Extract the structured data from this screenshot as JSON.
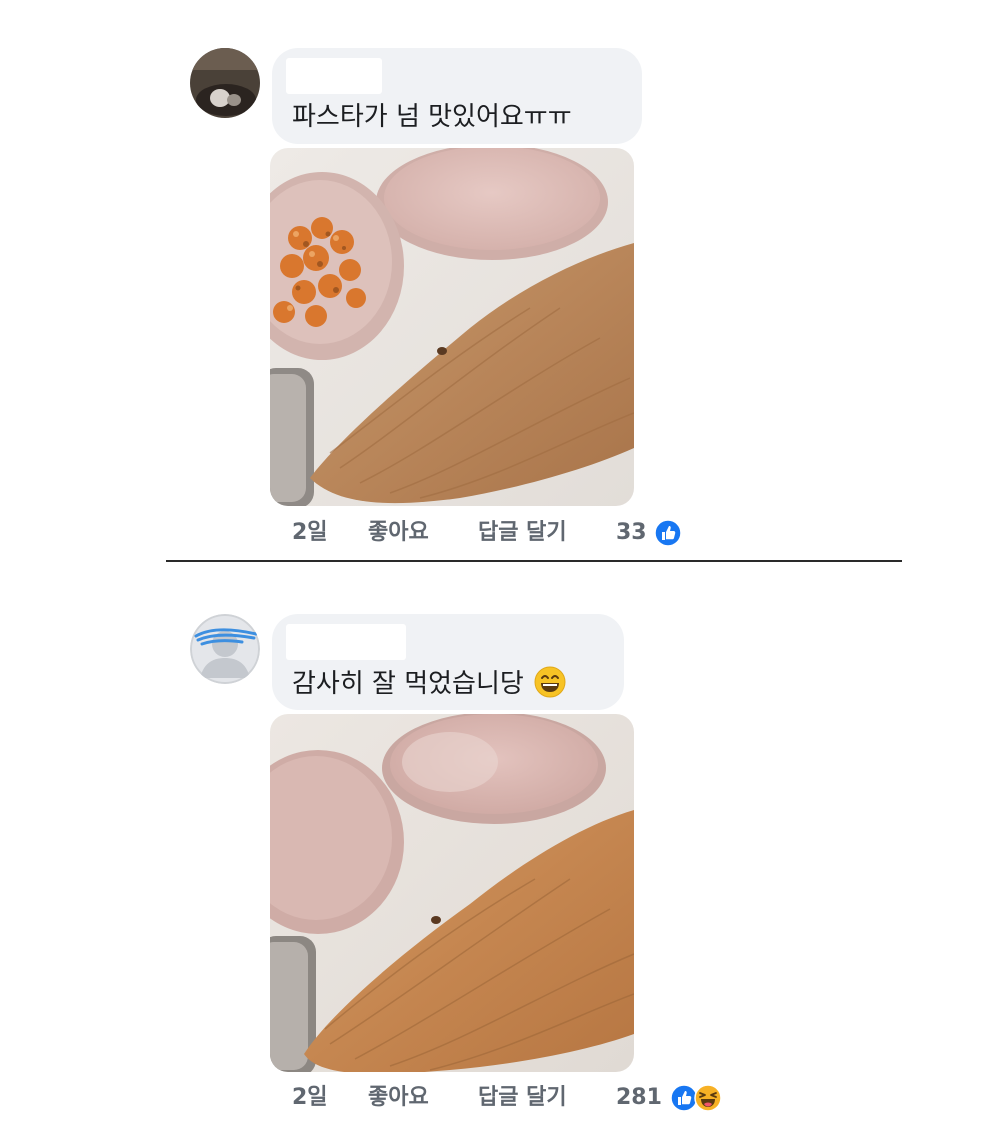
{
  "comments": [
    {
      "text": "파스타가 넘 맛있어요ㅠㅠ",
      "time": "2일",
      "like_label": "좋아요",
      "reply_label": "답글 달기",
      "reaction_count": "33",
      "reactions": [
        "like-icon"
      ],
      "emoji": ""
    },
    {
      "text": "감사히 잘 먹었습니당",
      "time": "2일",
      "like_label": "좋아요",
      "reply_label": "답글 달기",
      "reaction_count": "281",
      "reactions": [
        "like-icon",
        "haha-icon"
      ],
      "emoji": "grinning-emoji"
    }
  ],
  "colors": {
    "bubble": "#f0f2f5",
    "like_blue": "#1877f2",
    "haha_yellow": "#f7b125",
    "meta_text": "#606770"
  }
}
